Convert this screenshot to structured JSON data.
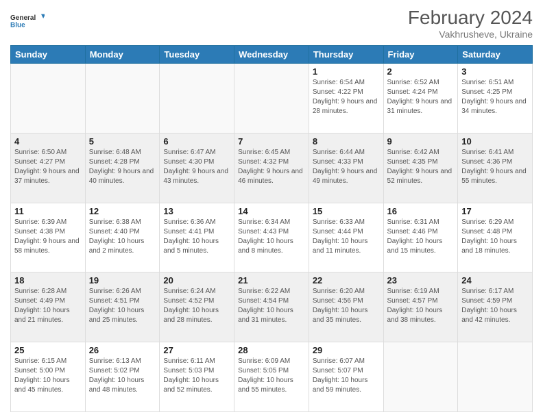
{
  "header": {
    "logo": {
      "line1": "General",
      "line2": "Blue"
    },
    "month": "February 2024",
    "location": "Vakhrusheve, Ukraine"
  },
  "days_of_week": [
    "Sunday",
    "Monday",
    "Tuesday",
    "Wednesday",
    "Thursday",
    "Friday",
    "Saturday"
  ],
  "weeks": [
    [
      {
        "day": "",
        "info": ""
      },
      {
        "day": "",
        "info": ""
      },
      {
        "day": "",
        "info": ""
      },
      {
        "day": "",
        "info": ""
      },
      {
        "day": "1",
        "info": "Sunrise: 6:54 AM\nSunset: 4:22 PM\nDaylight: 9 hours and 28 minutes."
      },
      {
        "day": "2",
        "info": "Sunrise: 6:52 AM\nSunset: 4:24 PM\nDaylight: 9 hours and 31 minutes."
      },
      {
        "day": "3",
        "info": "Sunrise: 6:51 AM\nSunset: 4:25 PM\nDaylight: 9 hours and 34 minutes."
      }
    ],
    [
      {
        "day": "4",
        "info": "Sunrise: 6:50 AM\nSunset: 4:27 PM\nDaylight: 9 hours and 37 minutes."
      },
      {
        "day": "5",
        "info": "Sunrise: 6:48 AM\nSunset: 4:28 PM\nDaylight: 9 hours and 40 minutes."
      },
      {
        "day": "6",
        "info": "Sunrise: 6:47 AM\nSunset: 4:30 PM\nDaylight: 9 hours and 43 minutes."
      },
      {
        "day": "7",
        "info": "Sunrise: 6:45 AM\nSunset: 4:32 PM\nDaylight: 9 hours and 46 minutes."
      },
      {
        "day": "8",
        "info": "Sunrise: 6:44 AM\nSunset: 4:33 PM\nDaylight: 9 hours and 49 minutes."
      },
      {
        "day": "9",
        "info": "Sunrise: 6:42 AM\nSunset: 4:35 PM\nDaylight: 9 hours and 52 minutes."
      },
      {
        "day": "10",
        "info": "Sunrise: 6:41 AM\nSunset: 4:36 PM\nDaylight: 9 hours and 55 minutes."
      }
    ],
    [
      {
        "day": "11",
        "info": "Sunrise: 6:39 AM\nSunset: 4:38 PM\nDaylight: 9 hours and 58 minutes."
      },
      {
        "day": "12",
        "info": "Sunrise: 6:38 AM\nSunset: 4:40 PM\nDaylight: 10 hours and 2 minutes."
      },
      {
        "day": "13",
        "info": "Sunrise: 6:36 AM\nSunset: 4:41 PM\nDaylight: 10 hours and 5 minutes."
      },
      {
        "day": "14",
        "info": "Sunrise: 6:34 AM\nSunset: 4:43 PM\nDaylight: 10 hours and 8 minutes."
      },
      {
        "day": "15",
        "info": "Sunrise: 6:33 AM\nSunset: 4:44 PM\nDaylight: 10 hours and 11 minutes."
      },
      {
        "day": "16",
        "info": "Sunrise: 6:31 AM\nSunset: 4:46 PM\nDaylight: 10 hours and 15 minutes."
      },
      {
        "day": "17",
        "info": "Sunrise: 6:29 AM\nSunset: 4:48 PM\nDaylight: 10 hours and 18 minutes."
      }
    ],
    [
      {
        "day": "18",
        "info": "Sunrise: 6:28 AM\nSunset: 4:49 PM\nDaylight: 10 hours and 21 minutes."
      },
      {
        "day": "19",
        "info": "Sunrise: 6:26 AM\nSunset: 4:51 PM\nDaylight: 10 hours and 25 minutes."
      },
      {
        "day": "20",
        "info": "Sunrise: 6:24 AM\nSunset: 4:52 PM\nDaylight: 10 hours and 28 minutes."
      },
      {
        "day": "21",
        "info": "Sunrise: 6:22 AM\nSunset: 4:54 PM\nDaylight: 10 hours and 31 minutes."
      },
      {
        "day": "22",
        "info": "Sunrise: 6:20 AM\nSunset: 4:56 PM\nDaylight: 10 hours and 35 minutes."
      },
      {
        "day": "23",
        "info": "Sunrise: 6:19 AM\nSunset: 4:57 PM\nDaylight: 10 hours and 38 minutes."
      },
      {
        "day": "24",
        "info": "Sunrise: 6:17 AM\nSunset: 4:59 PM\nDaylight: 10 hours and 42 minutes."
      }
    ],
    [
      {
        "day": "25",
        "info": "Sunrise: 6:15 AM\nSunset: 5:00 PM\nDaylight: 10 hours and 45 minutes."
      },
      {
        "day": "26",
        "info": "Sunrise: 6:13 AM\nSunset: 5:02 PM\nDaylight: 10 hours and 48 minutes."
      },
      {
        "day": "27",
        "info": "Sunrise: 6:11 AM\nSunset: 5:03 PM\nDaylight: 10 hours and 52 minutes."
      },
      {
        "day": "28",
        "info": "Sunrise: 6:09 AM\nSunset: 5:05 PM\nDaylight: 10 hours and 55 minutes."
      },
      {
        "day": "29",
        "info": "Sunrise: 6:07 AM\nSunset: 5:07 PM\nDaylight: 10 hours and 59 minutes."
      },
      {
        "day": "",
        "info": ""
      },
      {
        "day": "",
        "info": ""
      }
    ]
  ]
}
